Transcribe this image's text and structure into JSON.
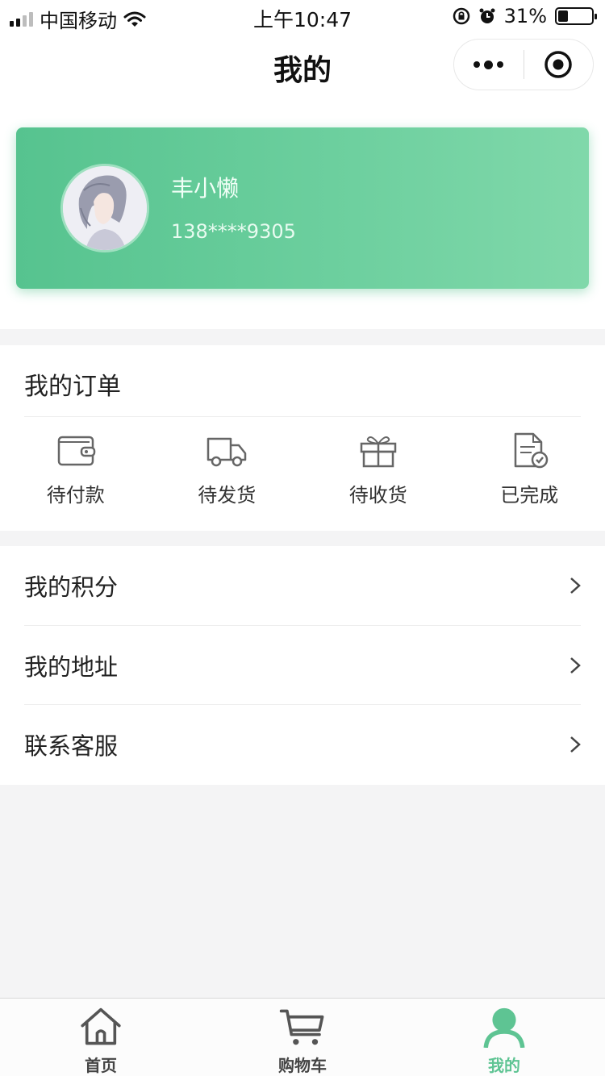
{
  "status_bar": {
    "carrier": "中国移动",
    "time": "上午10:47",
    "battery_text": "31%",
    "battery_level": 0.31
  },
  "nav": {
    "title": "我的"
  },
  "profile": {
    "name": "丰小懒",
    "phone": "138****9305"
  },
  "orders": {
    "title": "我的订单",
    "items": [
      {
        "label": "待付款",
        "icon": "wallet-icon"
      },
      {
        "label": "待发货",
        "icon": "truck-icon"
      },
      {
        "label": "待收货",
        "icon": "gift-icon"
      },
      {
        "label": "已完成",
        "icon": "document-check-icon"
      }
    ]
  },
  "menu": {
    "items": [
      {
        "label": "我的积分"
      },
      {
        "label": "我的地址"
      },
      {
        "label": "联系客服"
      }
    ]
  },
  "tabbar": {
    "items": [
      {
        "label": "首页",
        "icon": "home-icon"
      },
      {
        "label": "购物车",
        "icon": "cart-icon"
      },
      {
        "label": "我的",
        "icon": "user-icon",
        "active": true
      }
    ]
  },
  "colors": {
    "accent": "#5ec493",
    "card_start": "#56c38f",
    "card_end": "#80d8aa"
  }
}
